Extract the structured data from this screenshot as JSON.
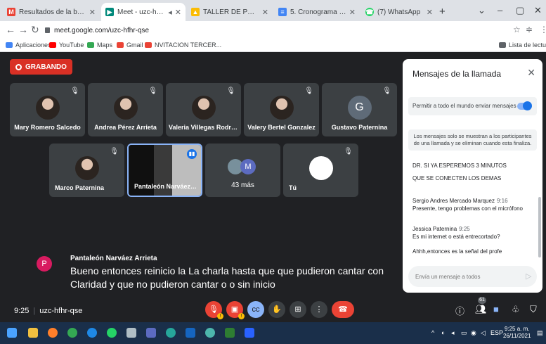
{
  "browser": {
    "tabs": [
      {
        "label": "Resultados de la búsqueda -",
        "icon": "gmail-icon",
        "color": "#ea4335"
      },
      {
        "label": "Meet - uzc-hfhr-qse",
        "icon": "meet-icon",
        "color": "#00897b"
      },
      {
        "label": "TALLER DE PRESTACIONES S",
        "icon": "drive-icon",
        "color": "#fbbc04"
      },
      {
        "label": "5. Cronograma Capacitacion",
        "icon": "forms-icon",
        "color": "#4285f4"
      },
      {
        "label": "(7) WhatsApp",
        "icon": "whatsapp-icon",
        "color": "#25d366"
      }
    ],
    "url": "meet.google.com/uzc-hfhr-qse",
    "bookmarks": [
      {
        "label": "Aplicaciones",
        "color": "#4285f4"
      },
      {
        "label": "YouTube",
        "color": "#ff0000"
      },
      {
        "label": "Maps",
        "color": "#34a853"
      },
      {
        "label": "Gmail",
        "color": "#ea4335"
      },
      {
        "label": "NVITACION TERCER...",
        "color": "#ea4335"
      }
    ],
    "reading_list": "Lista de lectura"
  },
  "meet": {
    "recording_label": "GRABANDO",
    "participants_row1": [
      {
        "name": "Mary Romero Salcedo",
        "avatar": "photo"
      },
      {
        "name": "Andrea Pérez Arrieta",
        "avatar": "photo"
      },
      {
        "name": "Valeria Villegas Rodríg...",
        "avatar": "photo"
      },
      {
        "name": "Valery Bertel Gonzalez",
        "avatar": "photo"
      },
      {
        "name": "Gustavo Paternina",
        "avatar": "initial",
        "initial": "G"
      }
    ],
    "participants_row2": [
      {
        "name": "Marco Paternina"
      },
      {
        "name": "Pantaleón Narváez A..."
      },
      {
        "name": "43 más",
        "initial": "M"
      },
      {
        "name": "Tú"
      }
    ],
    "caption": {
      "initial": "P",
      "speaker": "Pantaleón Narváez Arrieta",
      "text": "Bueno entonces reinicio la La charla hasta que que pudieron cantar con Claridad y que no pudieron cantar o o sin inicio"
    },
    "meeting_time": "9:25",
    "meeting_code": "uzc-hfhr-qse",
    "participant_count": "61"
  },
  "chat": {
    "title": "Mensajes de la llamada",
    "toggle_label": "Permitir a todo el mundo enviar mensajes",
    "notice": "Los mensajes solo se muestran a los participantes de una llamada y se eliminan cuando esta finaliza.",
    "messages": [
      {
        "text": "DR. SI YA ESPEREMOS 3 MINUTOS"
      },
      {
        "text": "QUE SE CONECTEN LOS DEMAS"
      },
      {
        "sender": "Sergio Andres Mercado Marquez",
        "time": "9:16",
        "text": "Presente, tengo problemas con el micrófono"
      },
      {
        "sender": "Jessica Paternina",
        "time": "9:25",
        "text": "Es mi internet o está entrecortado?"
      },
      {
        "text": "Ahhh,entonces es la señal del profe"
      }
    ],
    "input_placeholder": "Envía un mensaje a todos"
  },
  "taskbar": {
    "language": "ESP",
    "time": "9:25 a. m.",
    "date": "26/11/2021"
  }
}
